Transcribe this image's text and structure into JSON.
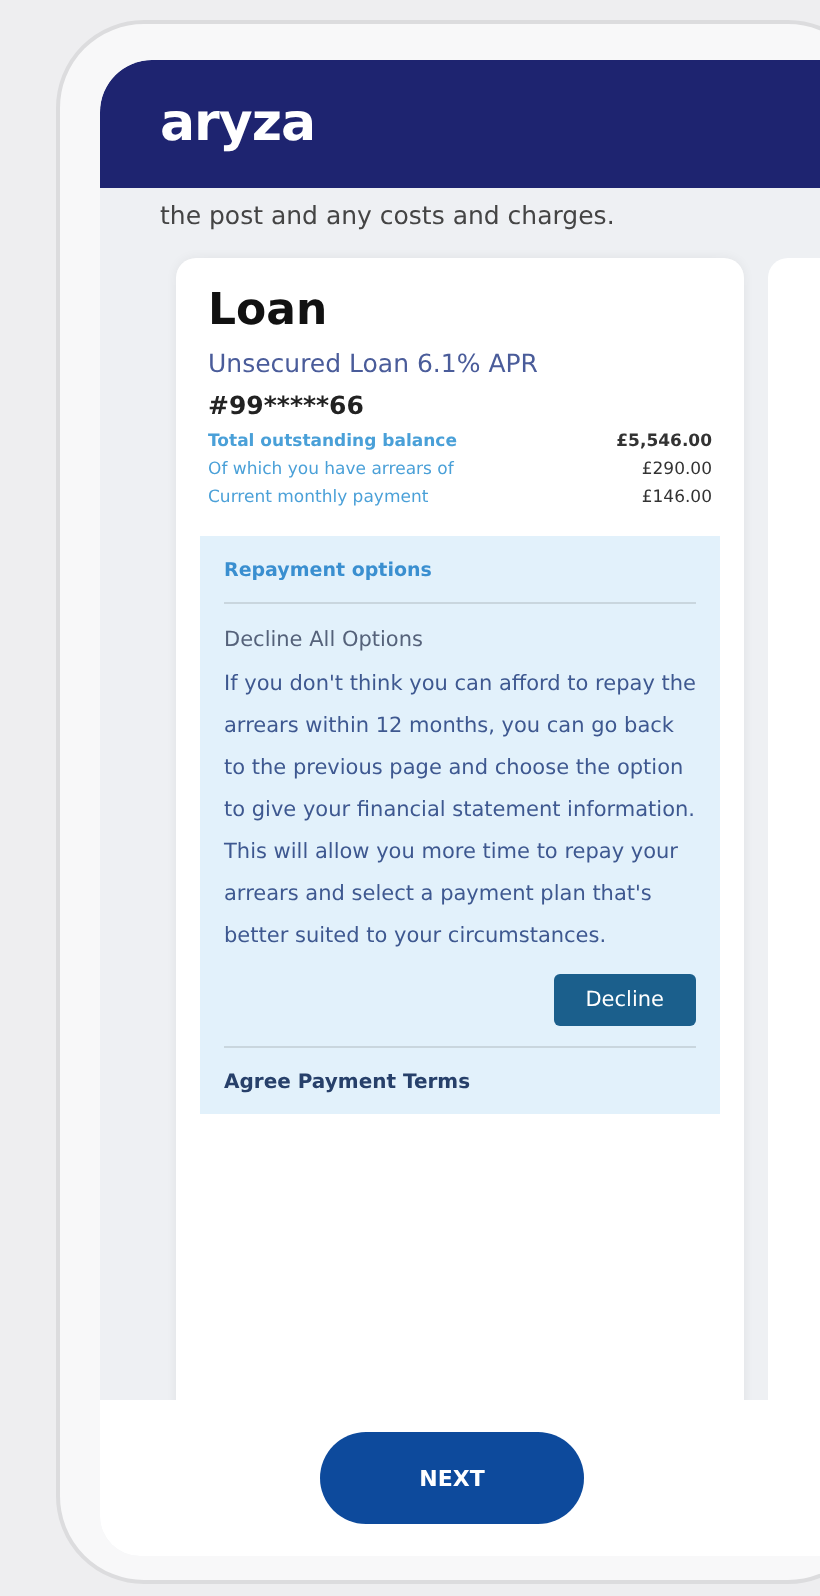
{
  "header": {
    "logo": "aryza"
  },
  "intro": "the post and any costs and charges.",
  "loan": {
    "title": "Loan",
    "subtitle": "Unsecured Loan 6.1% APR",
    "account": "#99*****66",
    "rows": [
      {
        "label": "Total outstanding balance",
        "value": "£5,546.00",
        "bold": true
      },
      {
        "label": "Of which you have arrears of",
        "value": "£290.00",
        "bold": false
      },
      {
        "label": "Current monthly payment",
        "value": "£146.00",
        "bold": false
      }
    ]
  },
  "repayment": {
    "heading": "Repayment options",
    "option_title": "Decline All Options",
    "body": "If you don't think you can afford to repay the arrears within 12 months, you can go back to the previous page and choose the option to give your financial statement information. This will allow you more time to repay your arrears and select a payment plan that's better suited to your circumstances.",
    "button": "Decline",
    "next_heading": "Agree Payment Terms"
  },
  "footer": {
    "button": "NEXT"
  }
}
